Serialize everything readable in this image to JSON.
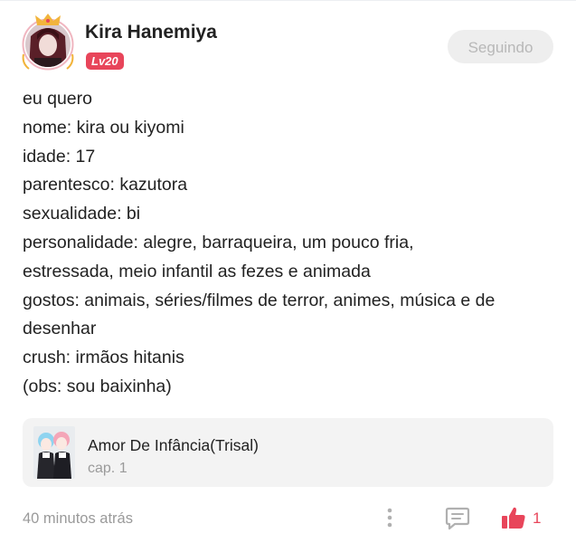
{
  "post": {
    "author": {
      "name": "Kira Hanemiya",
      "level": "Lv20",
      "level_color": "#e8455a"
    },
    "follow_button_label": "Seguindo",
    "lines": [
      "eu quero",
      "nome: kira ou kiyomi",
      "idade: 17",
      "parentesco: kazutora",
      "sexualidade: bi",
      "personalidade: alegre, barraqueira, um pouco fria,",
      "estressada, meio infantil as fezes e animada",
      "gostos: animais, séries/filmes de terror, animes, música e de",
      "desenhar",
      "crush: irmãos hitanis",
      "(obs: sou baixinha)"
    ],
    "story": {
      "title": "Amor De Infância(Trisal)",
      "chapter": "cap. 1"
    },
    "timestamp": "40 minutos atrás",
    "like_count": "1"
  },
  "icons": {
    "more": "more-vertical-icon",
    "comment": "comment-icon",
    "like": "thumbs-up-icon"
  }
}
